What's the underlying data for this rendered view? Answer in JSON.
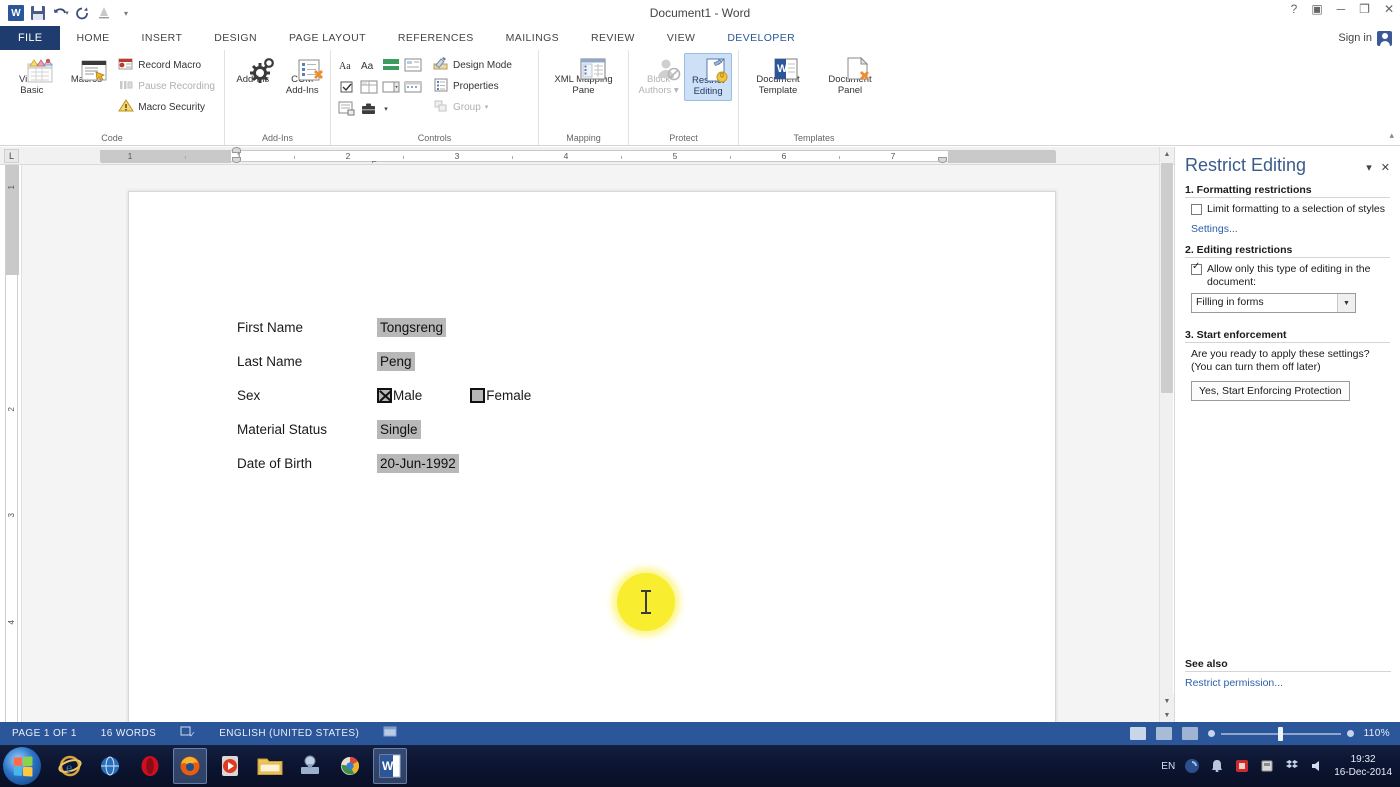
{
  "titlebar": {
    "document_title": "Document1 - Word",
    "qat": [
      {
        "name": "word-logo-icon",
        "label": "W"
      },
      {
        "name": "save-icon",
        "label": "Save"
      },
      {
        "name": "undo-icon",
        "label": "Undo"
      },
      {
        "name": "redo-icon",
        "label": "Redo"
      },
      {
        "name": "print-preview-icon",
        "label": "Print Preview"
      },
      {
        "name": "customize-qat-icon",
        "label": "Customize Quick Access Toolbar"
      }
    ],
    "window_controls": {
      "help": "?",
      "ribbon_display": "Ribbon Display Options",
      "minimize": "Minimize",
      "restore": "Restore Down",
      "close": "Close"
    },
    "sign_in": "Sign in"
  },
  "tabs": {
    "file": "FILE",
    "items": [
      "HOME",
      "INSERT",
      "DESIGN",
      "PAGE LAYOUT",
      "REFERENCES",
      "MAILINGS",
      "REVIEW",
      "VIEW",
      "DEVELOPER"
    ],
    "active": "DEVELOPER"
  },
  "ribbon": {
    "groups": [
      {
        "name": "code",
        "label": "Code",
        "big_buttons": [
          {
            "label": "Visual\nBasic",
            "label1": "Visual",
            "label2": "Basic",
            "icon": "visual-basic-icon"
          },
          {
            "label": "Macros",
            "label1": "Macros",
            "label2": "",
            "icon": "macros-icon"
          }
        ],
        "small_buttons": [
          {
            "label": "Record Macro",
            "icon": "record-macro-icon",
            "disabled": false
          },
          {
            "label": "Pause Recording",
            "icon": "pause-recording-icon",
            "disabled": true
          },
          {
            "label": "Macro Security",
            "icon": "macro-security-icon",
            "disabled": false
          }
        ]
      },
      {
        "name": "add-ins",
        "label": "Add-Ins",
        "big_buttons": [
          {
            "label1": "Add-Ins",
            "label2": "",
            "icon": "add-ins-icon"
          },
          {
            "label1": "COM",
            "label2": "Add-Ins",
            "icon": "com-add-ins-icon"
          }
        ],
        "small_buttons": []
      },
      {
        "name": "controls",
        "label": "Controls",
        "cells": [
          "rich-text-content-control-icon",
          "plain-text-content-control-icon",
          "picture-content-control-icon",
          "building-block-gallery-icon",
          "checkbox-content-control-icon",
          "combo-box-content-control-icon",
          "drop-down-list-content-control-icon",
          "date-picker-content-control-icon",
          "repeating-section-content-control-icon",
          "legacy-tools-icon"
        ],
        "small_buttons": [
          {
            "label": "Design Mode",
            "icon": "design-mode-icon",
            "disabled": false
          },
          {
            "label": "Properties",
            "icon": "properties-icon",
            "disabled": false
          },
          {
            "label": "Group",
            "icon": "group-icon",
            "disabled": true
          }
        ]
      },
      {
        "name": "mapping",
        "label": "Mapping",
        "big_buttons": [
          {
            "label1": "XML Mapping",
            "label2": "Pane",
            "icon": "xml-mapping-pane-icon"
          }
        ],
        "small_buttons": []
      },
      {
        "name": "protect",
        "label": "Protect",
        "big_buttons": [
          {
            "label1": "Block",
            "label2": "Authors ▾",
            "icon": "block-authors-icon",
            "disabled": true
          },
          {
            "label1": "Restrict",
            "label2": "Editing",
            "icon": "restrict-editing-icon",
            "selected": true
          }
        ],
        "small_buttons": []
      },
      {
        "name": "templates",
        "label": "Templates",
        "big_buttons": [
          {
            "label1": "Document",
            "label2": "Template",
            "icon": "document-template-icon"
          },
          {
            "label1": "Document",
            "label2": "Panel",
            "icon": "document-panel-icon"
          }
        ],
        "small_buttons": []
      }
    ],
    "collapse_label": "▴"
  },
  "ruler": {
    "tab_selector": "L",
    "numbers": [
      "1",
      "2",
      "3",
      "4",
      "5",
      "6",
      "7"
    ],
    "vertical_numbers": [
      "1",
      "2",
      "3",
      "4"
    ]
  },
  "document": {
    "form_rows": [
      {
        "label": "First Name",
        "value": "Tongsreng",
        "type": "text"
      },
      {
        "label": "Last Name",
        "value": "Peng",
        "type": "text"
      },
      {
        "label": "Sex",
        "type": "checkboxes",
        "options": [
          {
            "label": "Male",
            "checked": true
          },
          {
            "label": "Female",
            "checked": false
          }
        ]
      },
      {
        "label": "Material Status",
        "value": "Single",
        "type": "text"
      },
      {
        "label": "Date of Birth",
        "value": "20-Jun-1992",
        "type": "text"
      }
    ]
  },
  "pane": {
    "title": "Restrict Editing",
    "controls": {
      "dropdown": "▾",
      "close": "✕"
    },
    "section1": {
      "title": "1. Formatting restrictions",
      "checkbox_label": "Limit formatting to a selection of styles",
      "checked": false,
      "settings_link": "Settings..."
    },
    "section2": {
      "title": "2. Editing restrictions",
      "checkbox_label": "Allow only this type of editing in the document:",
      "checked": true,
      "select_value": "Filling in forms"
    },
    "section3": {
      "title": "3. Start enforcement",
      "paragraph": "Are you ready to apply these settings? (You can turn them off later)",
      "button": "Yes, Start Enforcing Protection"
    },
    "see_also": {
      "title": "See also",
      "link": "Restrict permission..."
    }
  },
  "statusbar": {
    "page": "PAGE 1 OF 1",
    "words": "16 WORDS",
    "proofing_icon": "proofing-errors-icon",
    "language": "ENGLISH (UNITED STATES)",
    "macro_icon": "macro-recording-icon",
    "view_buttons": [
      "read-mode-icon",
      "print-layout-icon",
      "web-layout-icon"
    ],
    "zoom": "110%"
  },
  "taskbar": {
    "start": "start-orb-icon",
    "items": [
      "internet-explorer-icon",
      "globe-browser-icon",
      "opera-icon",
      "firefox-icon",
      "media-player-icon",
      "file-explorer-icon",
      "screen-recorder-icon",
      "chrome-like-icon",
      "word-taskbar-icon"
    ],
    "active_item": "word-taskbar-icon",
    "tray": {
      "language": "EN",
      "icons": [
        "network-icon",
        "action-center-icon",
        "antivirus-icon",
        "usb-icon",
        "dropbox-icon",
        "volume-icon"
      ],
      "time": "19:32",
      "date": "16-Dec-2014"
    }
  }
}
